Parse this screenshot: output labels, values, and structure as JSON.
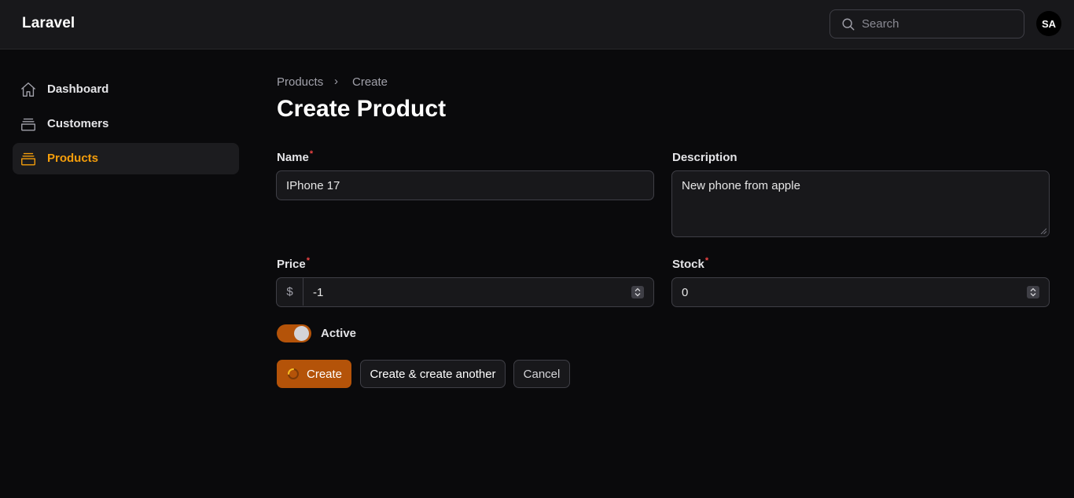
{
  "app": {
    "brand": "Laravel"
  },
  "header": {
    "search_placeholder": "Search",
    "avatar_initials": "SA"
  },
  "sidebar": {
    "items": [
      {
        "label": "Dashboard",
        "icon": "home-icon",
        "active": false
      },
      {
        "label": "Customers",
        "icon": "stack-icon",
        "active": false
      },
      {
        "label": "Products",
        "icon": "stack-icon",
        "active": true
      }
    ]
  },
  "breadcrumb": {
    "parent": "Products",
    "separator": "›",
    "current": "Create"
  },
  "page": {
    "title": "Create Product"
  },
  "form": {
    "name": {
      "label": "Name",
      "required": "*",
      "value": "IPhone 17"
    },
    "description": {
      "label": "Description",
      "value": "New phone from apple"
    },
    "price": {
      "label": "Price",
      "required": "*",
      "prefix": "$",
      "value": "-1"
    },
    "stock": {
      "label": "Stock",
      "required": "*",
      "value": "0"
    },
    "active": {
      "label": "Active",
      "enabled": true
    }
  },
  "actions": {
    "create": "Create",
    "create_another": "Create & create another",
    "cancel": "Cancel"
  },
  "colors": {
    "accent": "#f59e0b",
    "primary_button": "#b45309",
    "background": "#0a0a0c",
    "surface": "#18181b",
    "required": "#ef4444"
  }
}
